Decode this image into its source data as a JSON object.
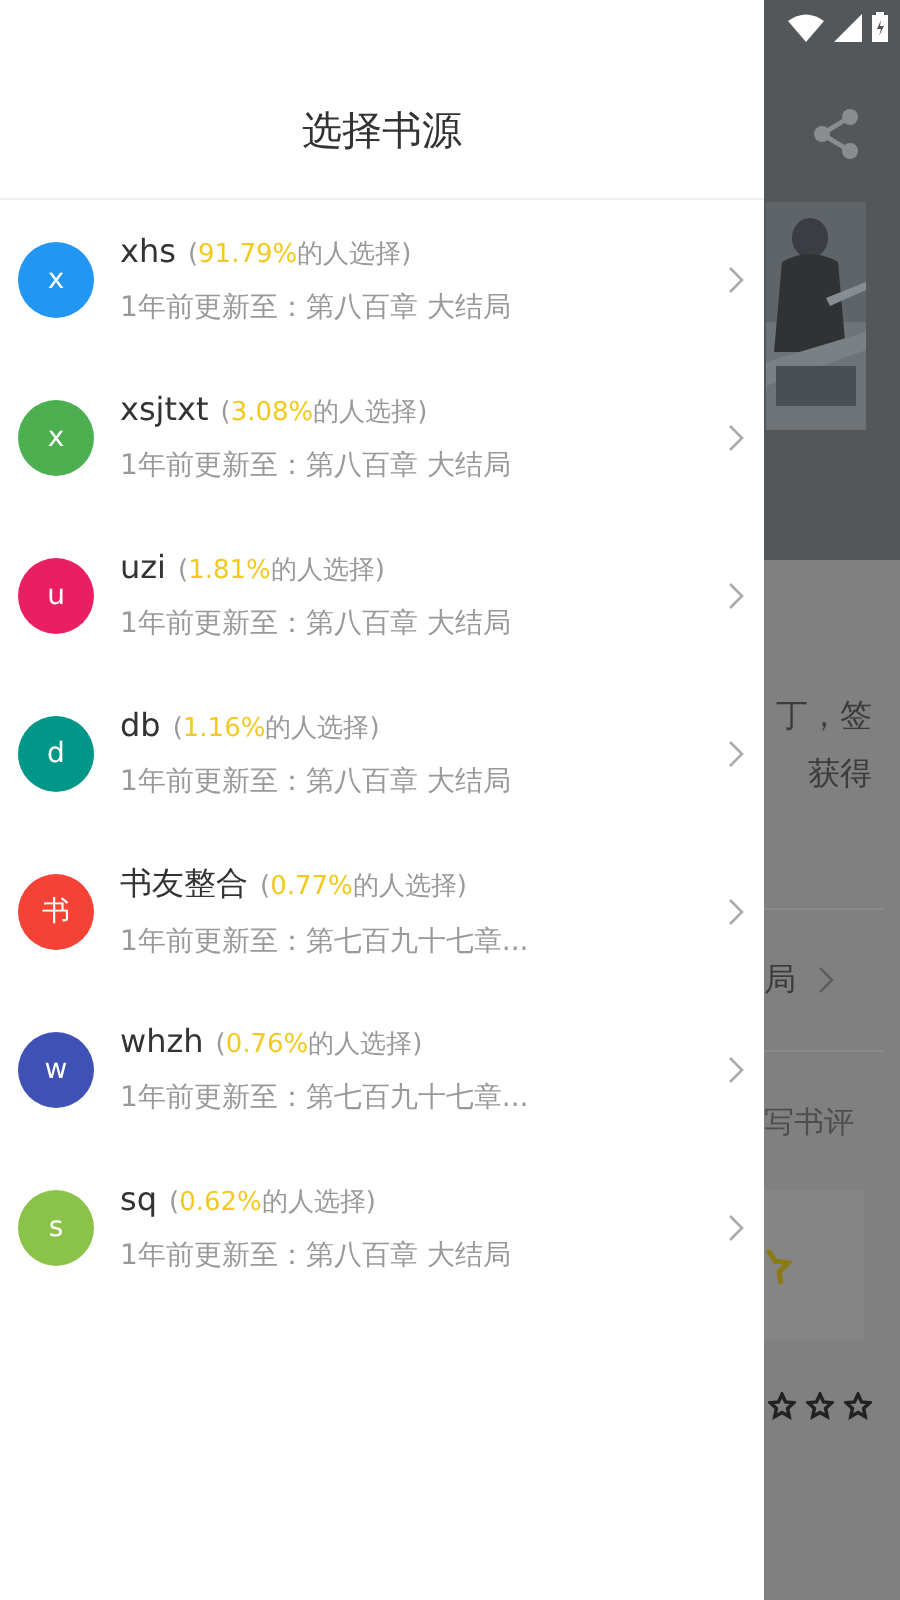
{
  "drawer": {
    "title": "选择书源",
    "sources": [
      {
        "avatar": "x",
        "color": "#2196f3",
        "name": "xhs",
        "rate_open": "(",
        "percent": "91.79%",
        "rate_rest": "的人选择)",
        "update": "1年前更新至：第八百章 大结局"
      },
      {
        "avatar": "x",
        "color": "#4caf50",
        "name": "xsjtxt",
        "rate_open": "(",
        "percent": "3.08%",
        "rate_rest": "的人选择)",
        "update": "1年前更新至：第八百章 大结局"
      },
      {
        "avatar": "u",
        "color": "#e91e63",
        "name": "uzi",
        "rate_open": "(",
        "percent": "1.81%",
        "rate_rest": "的人选择)",
        "update": "1年前更新至：第八百章 大结局"
      },
      {
        "avatar": "d",
        "color": "#009688",
        "name": "db",
        "rate_open": "(",
        "percent": "1.16%",
        "rate_rest": "的人选择)",
        "update": "1年前更新至：第八百章 大结局"
      },
      {
        "avatar": "书",
        "color": "#f44336",
        "name": "书友整合",
        "rate_open": "(",
        "percent": "0.77%",
        "rate_rest": "的人选择)",
        "update": "1年前更新至：第七百九十七章..."
      },
      {
        "avatar": "w",
        "color": "#3f51b5",
        "name": "whzh",
        "rate_open": "(",
        "percent": "0.76%",
        "rate_rest": "的人选择)",
        "update": "1年前更新至：第七百九十七章..."
      },
      {
        "avatar": "s",
        "color": "#8bc34a",
        "name": "sq",
        "rate_open": "(",
        "percent": "0.62%",
        "rate_rest": "的人选择)",
        "update": "1年前更新至：第八百章 大结局"
      }
    ]
  },
  "background": {
    "intro_lines": [
      "丁，签",
      "获得"
    ],
    "chapter": "局",
    "review_link": "写书评"
  }
}
